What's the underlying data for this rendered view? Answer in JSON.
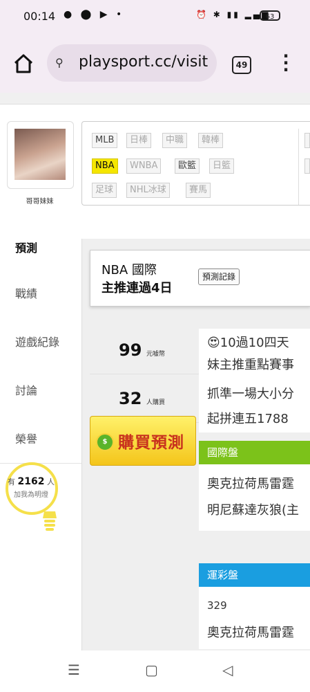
{
  "status_bar": {
    "time": "00:14",
    "battery": "63",
    "left_icons": "chat-icon, notification-icon, youtube-icon, dot",
    "right_icons": "alarm-icon, bluetooth-icon, volte-icon, 4g-signal-icon"
  },
  "browser": {
    "url": "playsport.cc/visit",
    "tab_count": "49"
  },
  "profile": {
    "name": "哥哥妹妹"
  },
  "leagues": [
    {
      "label": "MLB",
      "state": "available"
    },
    {
      "label": "日棒",
      "state": "disabled"
    },
    {
      "label": "中職",
      "state": "disabled"
    },
    {
      "label": "韓棒",
      "state": "disabled"
    },
    {
      "label": "NBA",
      "state": "selected"
    },
    {
      "label": "WNBA",
      "state": "disabled"
    },
    {
      "label": "歐籃",
      "state": "available"
    },
    {
      "label": "日籃",
      "state": "disabled"
    },
    {
      "label": "足球",
      "state": "disabled"
    },
    {
      "label": "NHL冰球",
      "state": "disabled"
    },
    {
      "label": "賽馬",
      "state": "disabled"
    }
  ],
  "sidebar": {
    "items": [
      {
        "label": "預測"
      },
      {
        "label": "戰績"
      },
      {
        "label": "遊戲紀錄"
      },
      {
        "label": "討論"
      },
      {
        "label": "榮譽"
      }
    ],
    "follow_prefix": "有",
    "follow_count": "2162",
    "follow_suffix": "人",
    "follow_caption": "加我為明燈"
  },
  "prediction": {
    "league_title": "NBA 國際",
    "streak": "主推連過4日",
    "record_button": "預測記錄",
    "price": "99",
    "price_unit": "元噱幣",
    "buyers": "32",
    "buyers_unit": "人購買",
    "buy_button": "購買預測",
    "analysis_lines": [
      "😍10過10四天",
      "妹主推重點賽事",
      "抓準一場大小分",
      "起拼連五1788"
    ],
    "intl_label": "國際盤",
    "intl_lines": [
      "奧克拉荷馬雷霆",
      "明尼蘇達灰狼(主"
    ],
    "lottery_label": "運彩盤",
    "lottery_code": "329",
    "lottery_team": "奧克拉荷馬雷霆"
  },
  "colors": {
    "selected_chip": "#f5e600",
    "intl_header": "#7cc21a",
    "lottery_header": "#1a9ee0",
    "buy_button_text": "#c8321e"
  }
}
